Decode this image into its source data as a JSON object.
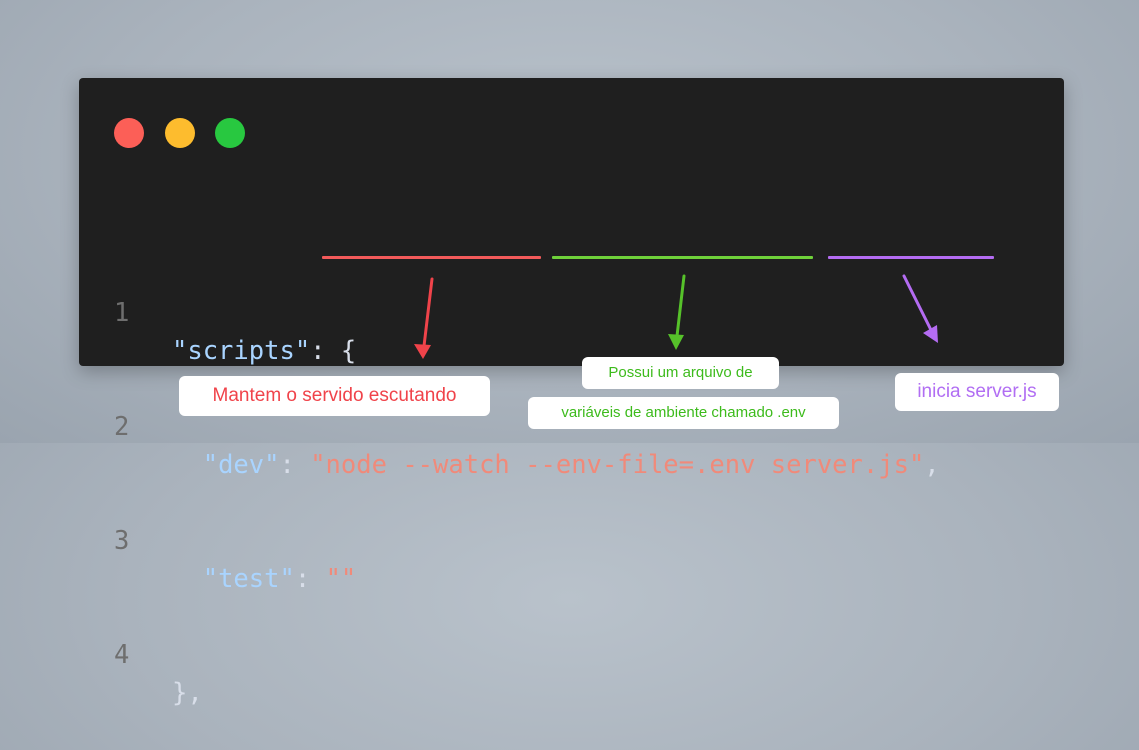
{
  "window": {
    "controls": [
      "close",
      "minimize",
      "maximize"
    ]
  },
  "code": {
    "lines": [
      {
        "number": "1",
        "indent": "",
        "key": "\"scripts\"",
        "sep": ": ",
        "rest": "{"
      },
      {
        "number": "2",
        "indent": "  ",
        "key": "\"dev\"",
        "sep": ": ",
        "str": "\"node --watch --env-file=.env server.js\"",
        "rest": ","
      },
      {
        "number": "3",
        "indent": "  ",
        "key": "\"test\"",
        "sep": ": ",
        "str": "\"\"",
        "rest": ""
      },
      {
        "number": "4",
        "indent": "",
        "key": "",
        "sep": "",
        "rest": "},"
      }
    ]
  },
  "annotations": {
    "red": "Mantem o servido escutando",
    "green_line1": "Possui um arquivo de",
    "green_line2": "variáveis de ambiente chamado .env",
    "purple": "inicia server.js"
  },
  "colors": {
    "red": "#f25a5a",
    "green": "#6fd13a",
    "purple": "#b46cf2",
    "window_bg": "#1f1f1f"
  }
}
